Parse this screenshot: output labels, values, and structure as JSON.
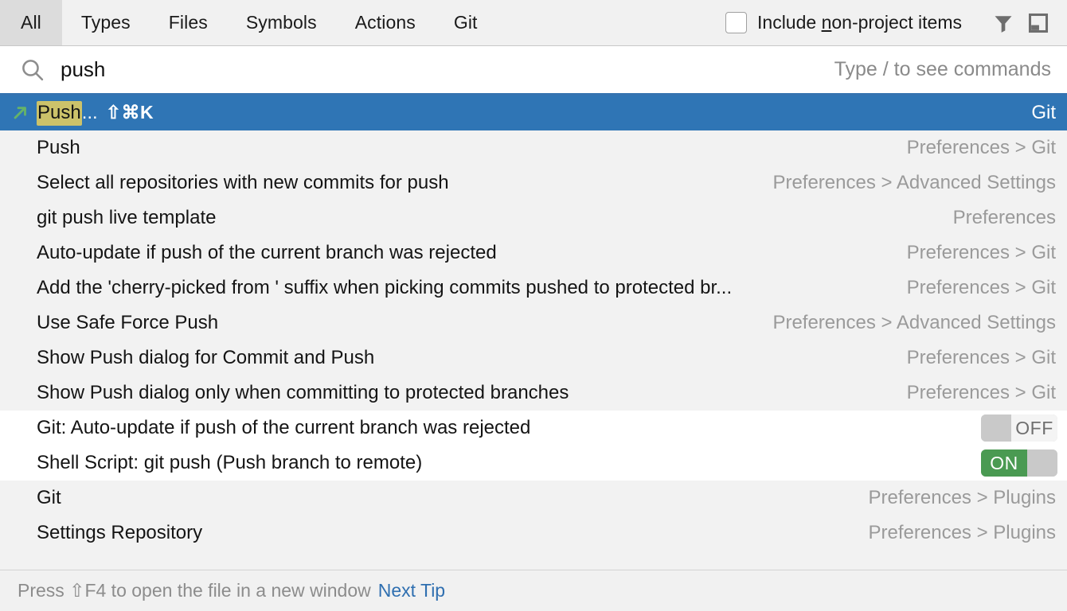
{
  "header": {
    "tabs": [
      {
        "label": "All",
        "selected": true
      },
      {
        "label": "Types",
        "selected": false
      },
      {
        "label": "Files",
        "selected": false
      },
      {
        "label": "Symbols",
        "selected": false
      },
      {
        "label": "Actions",
        "selected": false
      },
      {
        "label": "Git",
        "selected": false
      }
    ],
    "checkbox": {
      "label_before": "Include ",
      "mnemonic": "n",
      "label_after": "on-project items",
      "checked": false
    },
    "icons": [
      "filter-icon",
      "preview-panel-icon"
    ]
  },
  "search": {
    "value": "push",
    "placeholder": "",
    "hint": "Type / to see commands",
    "icon": "search-icon"
  },
  "results": [
    {
      "selected": true,
      "icon": "git-push-arrow-icon",
      "highlight": "Push",
      "text_after": "...",
      "shortcut": "⇧⌘K",
      "meta": "Git",
      "group": "selected"
    },
    {
      "selected": false,
      "text": "Push",
      "meta": "Preferences > Git",
      "group": "gray"
    },
    {
      "selected": false,
      "text": "Select all repositories with new commits for push",
      "meta": "Preferences > Advanced Settings",
      "group": "gray"
    },
    {
      "selected": false,
      "text": "git push live template",
      "meta": "Preferences",
      "group": "gray"
    },
    {
      "selected": false,
      "text": "Auto-update if push of the current branch was rejected",
      "meta": "Preferences > Git",
      "group": "gray"
    },
    {
      "selected": false,
      "text": "Add the 'cherry-picked from ' suffix when picking commits pushed to protected br...",
      "meta": "Preferences > Git",
      "group": "gray"
    },
    {
      "selected": false,
      "text": "Use Safe Force Push",
      "meta": "Preferences > Advanced Settings",
      "group": "gray"
    },
    {
      "selected": false,
      "text": "Show Push dialog for Commit and Push",
      "meta": "Preferences > Git",
      "group": "gray"
    },
    {
      "selected": false,
      "text": "Show Push dialog only when committing to protected branches",
      "meta": "Preferences > Git",
      "group": "gray"
    },
    {
      "selected": false,
      "text": "Git: Auto-update if push of the current branch was rejected",
      "toggle": "OFF",
      "toggle_state": "off",
      "group": "white"
    },
    {
      "selected": false,
      "text": "Shell Script: git push (Push branch to remote)",
      "toggle": "ON",
      "toggle_state": "on",
      "group": "white"
    },
    {
      "selected": false,
      "text": "Git",
      "meta": "Preferences > Plugins",
      "group": "gray"
    },
    {
      "selected": false,
      "text": "Settings Repository",
      "meta": "Preferences > Plugins",
      "group": "gray"
    }
  ],
  "footer": {
    "tip": "Press ⇧F4 to open the file in a new window",
    "link": "Next Tip"
  },
  "colors": {
    "selection": "#2f75b5",
    "highlight": "#ccc26a",
    "toggle_on": "#4a9a52",
    "link": "#2f6fb0",
    "accent_underline": "#3573b0"
  }
}
